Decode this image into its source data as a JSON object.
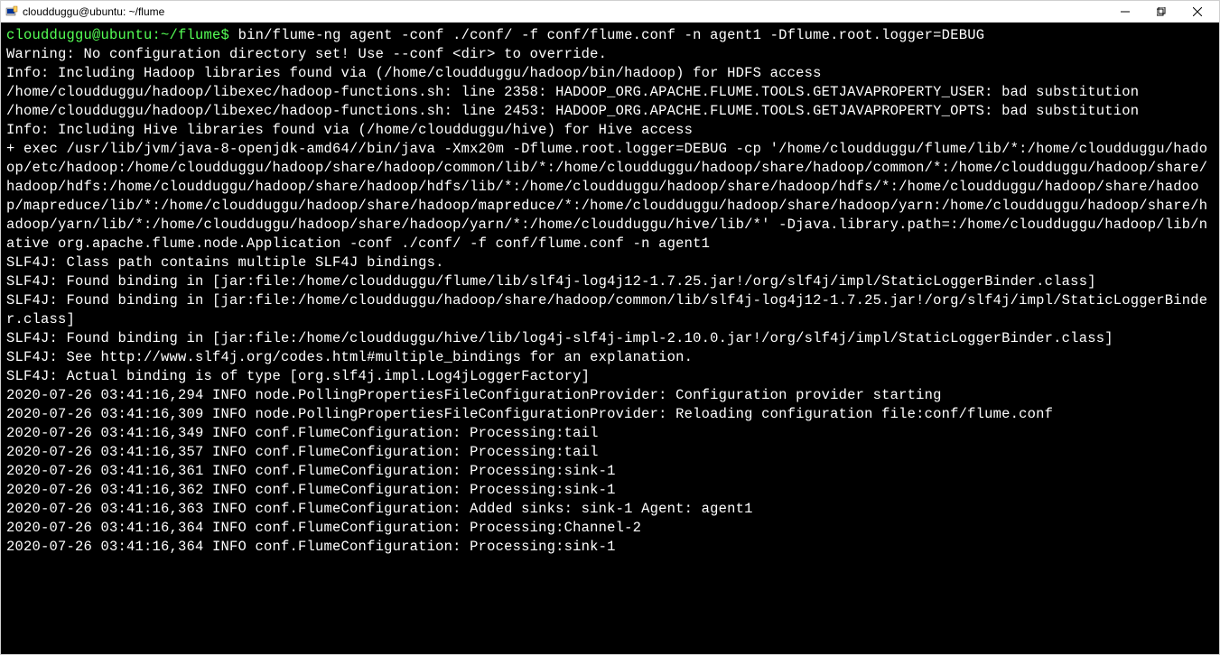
{
  "titlebar": {
    "title": "cloudduggu@ubuntu: ~/flume"
  },
  "terminal": {
    "prompt": "cloudduggu@ubuntu:~/flume$",
    "command": "bin/flume-ng agent -conf ./conf/ -f conf/flume.conf -n agent1 -Dflume.root.logger=DEBUG",
    "lines": [
      "Warning: No configuration directory set! Use --conf <dir> to override.",
      "Info: Including Hadoop libraries found via (/home/cloudduggu/hadoop/bin/hadoop) for HDFS access",
      "/home/cloudduggu/hadoop/libexec/hadoop-functions.sh: line 2358: HADOOP_ORG.APACHE.FLUME.TOOLS.GETJAVAPROPERTY_USER: bad substitution",
      "/home/cloudduggu/hadoop/libexec/hadoop-functions.sh: line 2453: HADOOP_ORG.APACHE.FLUME.TOOLS.GETJAVAPROPERTY_OPTS: bad substitution",
      "Info: Including Hive libraries found via (/home/cloudduggu/hive) for Hive access",
      "+ exec /usr/lib/jvm/java-8-openjdk-amd64//bin/java -Xmx20m -Dflume.root.logger=DEBUG -cp '/home/cloudduggu/flume/lib/*:/home/cloudduggu/hadoop/etc/hadoop:/home/cloudduggu/hadoop/share/hadoop/common/lib/*:/home/cloudduggu/hadoop/share/hadoop/common/*:/home/cloudduggu/hadoop/share/hadoop/hdfs:/home/cloudduggu/hadoop/share/hadoop/hdfs/lib/*:/home/cloudduggu/hadoop/share/hadoop/hdfs/*:/home/cloudduggu/hadoop/share/hadoop/mapreduce/lib/*:/home/cloudduggu/hadoop/share/hadoop/mapreduce/*:/home/cloudduggu/hadoop/share/hadoop/yarn:/home/cloudduggu/hadoop/share/hadoop/yarn/lib/*:/home/cloudduggu/hadoop/share/hadoop/yarn/*:/home/cloudduggu/hive/lib/*' -Djava.library.path=:/home/cloudduggu/hadoop/lib/native org.apache.flume.node.Application -conf ./conf/ -f conf/flume.conf -n agent1",
      "SLF4J: Class path contains multiple SLF4J bindings.",
      "SLF4J: Found binding in [jar:file:/home/cloudduggu/flume/lib/slf4j-log4j12-1.7.25.jar!/org/slf4j/impl/StaticLoggerBinder.class]",
      "SLF4J: Found binding in [jar:file:/home/cloudduggu/hadoop/share/hadoop/common/lib/slf4j-log4j12-1.7.25.jar!/org/slf4j/impl/StaticLoggerBinder.class]",
      "SLF4J: Found binding in [jar:file:/home/cloudduggu/hive/lib/log4j-slf4j-impl-2.10.0.jar!/org/slf4j/impl/StaticLoggerBinder.class]",
      "SLF4J: See http://www.slf4j.org/codes.html#multiple_bindings for an explanation.",
      "SLF4J: Actual binding is of type [org.slf4j.impl.Log4jLoggerFactory]",
      "2020-07-26 03:41:16,294 INFO node.PollingPropertiesFileConfigurationProvider: Configuration provider starting",
      "2020-07-26 03:41:16,309 INFO node.PollingPropertiesFileConfigurationProvider: Reloading configuration file:conf/flume.conf",
      "2020-07-26 03:41:16,349 INFO conf.FlumeConfiguration: Processing:tail",
      "2020-07-26 03:41:16,357 INFO conf.FlumeConfiguration: Processing:tail",
      "2020-07-26 03:41:16,361 INFO conf.FlumeConfiguration: Processing:sink-1",
      "2020-07-26 03:41:16,362 INFO conf.FlumeConfiguration: Processing:sink-1",
      "2020-07-26 03:41:16,363 INFO conf.FlumeConfiguration: Added sinks: sink-1 Agent: agent1",
      "2020-07-26 03:41:16,364 INFO conf.FlumeConfiguration: Processing:Channel-2",
      "2020-07-26 03:41:16,364 INFO conf.FlumeConfiguration: Processing:sink-1"
    ]
  }
}
